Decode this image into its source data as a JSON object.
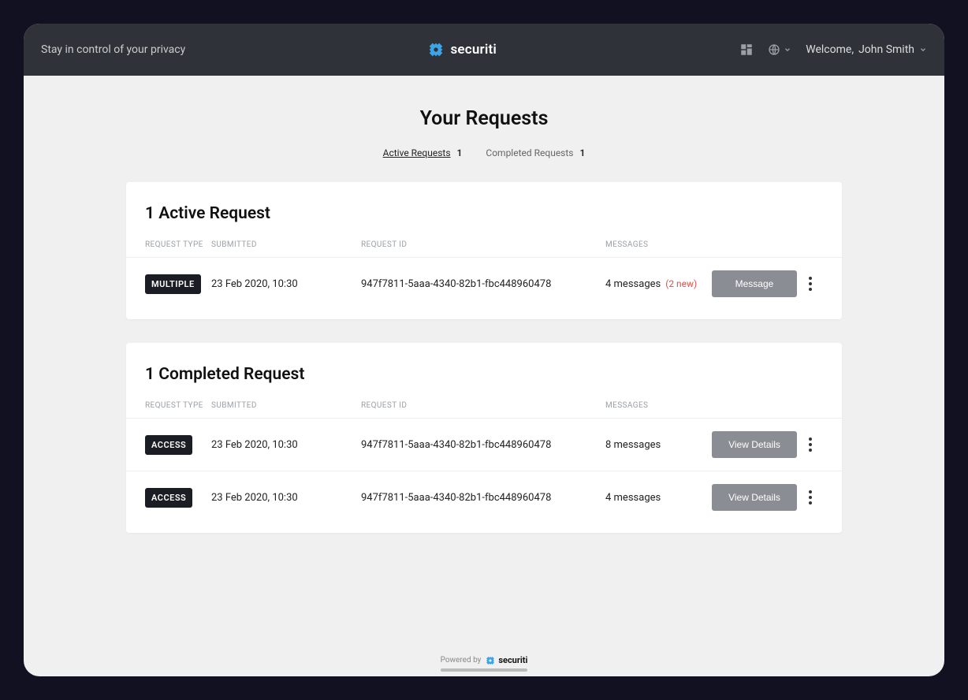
{
  "header": {
    "tagline": "Stay in control of your privacy",
    "brand": "securiti",
    "welcome_prefix": "Welcome, ",
    "user_name": "John Smith"
  },
  "page": {
    "title": "Your Requests"
  },
  "tabs": {
    "active": {
      "label": "Active Requests",
      "count": "1"
    },
    "completed": {
      "label": "Completed Requests",
      "count": "1"
    }
  },
  "columns": {
    "request_type": "REQUEST TYPE",
    "submitted": "SUBMITTED",
    "request_id": "REQUEST ID",
    "messages": "MESSAGES"
  },
  "active_section": {
    "title": "1 Active Request",
    "rows": [
      {
        "type": "MULTIPLE",
        "submitted": "23 Feb 2020, 10:30",
        "request_id": "947f7811-5aaa-4340-82b1-fbc448960478",
        "messages": "4 messages",
        "new": "(2 new)",
        "action": "Message"
      }
    ]
  },
  "completed_section": {
    "title": "1 Completed Request",
    "rows": [
      {
        "type": "ACCESS",
        "submitted": "23 Feb 2020, 10:30",
        "request_id": "947f7811-5aaa-4340-82b1-fbc448960478",
        "messages": "8 messages",
        "action": "View Details"
      },
      {
        "type": "ACCESS",
        "submitted": "23 Feb 2020, 10:30",
        "request_id": "947f7811-5aaa-4340-82b1-fbc448960478",
        "messages": "4 messages",
        "action": "View Details"
      }
    ]
  },
  "footer": {
    "powered_by": "Powered by",
    "brand": "securiti"
  }
}
